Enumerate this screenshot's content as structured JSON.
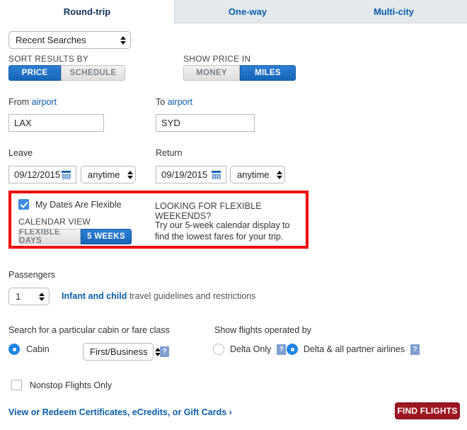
{
  "tabs": [
    {
      "label": "Round-trip",
      "active": true
    },
    {
      "label": "One-way",
      "active": false
    },
    {
      "label": "Multi-city",
      "active": false
    }
  ],
  "recent_searches": {
    "value": "Recent Searches"
  },
  "sort_results": {
    "label": "SORT RESULTS BY",
    "options": [
      {
        "label": "PRICE",
        "selected": true
      },
      {
        "label": "SCHEDULE",
        "selected": false
      }
    ]
  },
  "show_price_in": {
    "label": "SHOW PRICE IN",
    "options": [
      {
        "label": "MONEY",
        "selected": false
      },
      {
        "label": "MILES",
        "selected": true
      }
    ]
  },
  "from_airport": {
    "label_prefix": "From ",
    "label_link": "airport",
    "value": "LAX"
  },
  "to_airport": {
    "label_prefix": "To ",
    "label_link": "airport",
    "value": "SYD"
  },
  "leave": {
    "label": "Leave",
    "date": "09/12/2015",
    "time": "anytime"
  },
  "return": {
    "label": "Return",
    "date": "09/19/2015",
    "time": "anytime"
  },
  "flexible": {
    "checkbox_label": "My Dates Are Flexible",
    "checked": true,
    "calendar_view_label": "CALENDAR VIEW",
    "view_options": [
      {
        "label": "FLEXIBLE DAYS",
        "selected": false
      },
      {
        "label": "5 WEEKS",
        "selected": true
      }
    ],
    "promo_heading": "LOOKING FOR FLEXIBLE WEEKENDS?",
    "promo_body": "Try our 5-week calendar display to find the lowest fares for your trip.",
    "highlight_color": "#f40000"
  },
  "passengers": {
    "label": "Passengers",
    "count": "1",
    "link_text": "Infant and child",
    "link_suffix": " travel guidelines and restrictions"
  },
  "cabin": {
    "heading": "Search for a particular cabin or fare class",
    "radio_label": "Cabin",
    "radio_selected": true,
    "class_value": "First/Business",
    "help_glyph": "?"
  },
  "operated_by": {
    "heading": "Show flights operated by",
    "options": [
      {
        "label": "Delta Only",
        "selected": false,
        "help_glyph": "?"
      },
      {
        "label": "Delta & all partner airlines",
        "selected": true,
        "help_glyph": "?"
      }
    ]
  },
  "nonstop": {
    "label": "Nonstop Flights Only",
    "checked": false
  },
  "footer": {
    "certificates_link": "View or Redeem Certificates, eCredits, or Gift Cards ›",
    "find_flights_label": "FIND FLIGHTS"
  }
}
